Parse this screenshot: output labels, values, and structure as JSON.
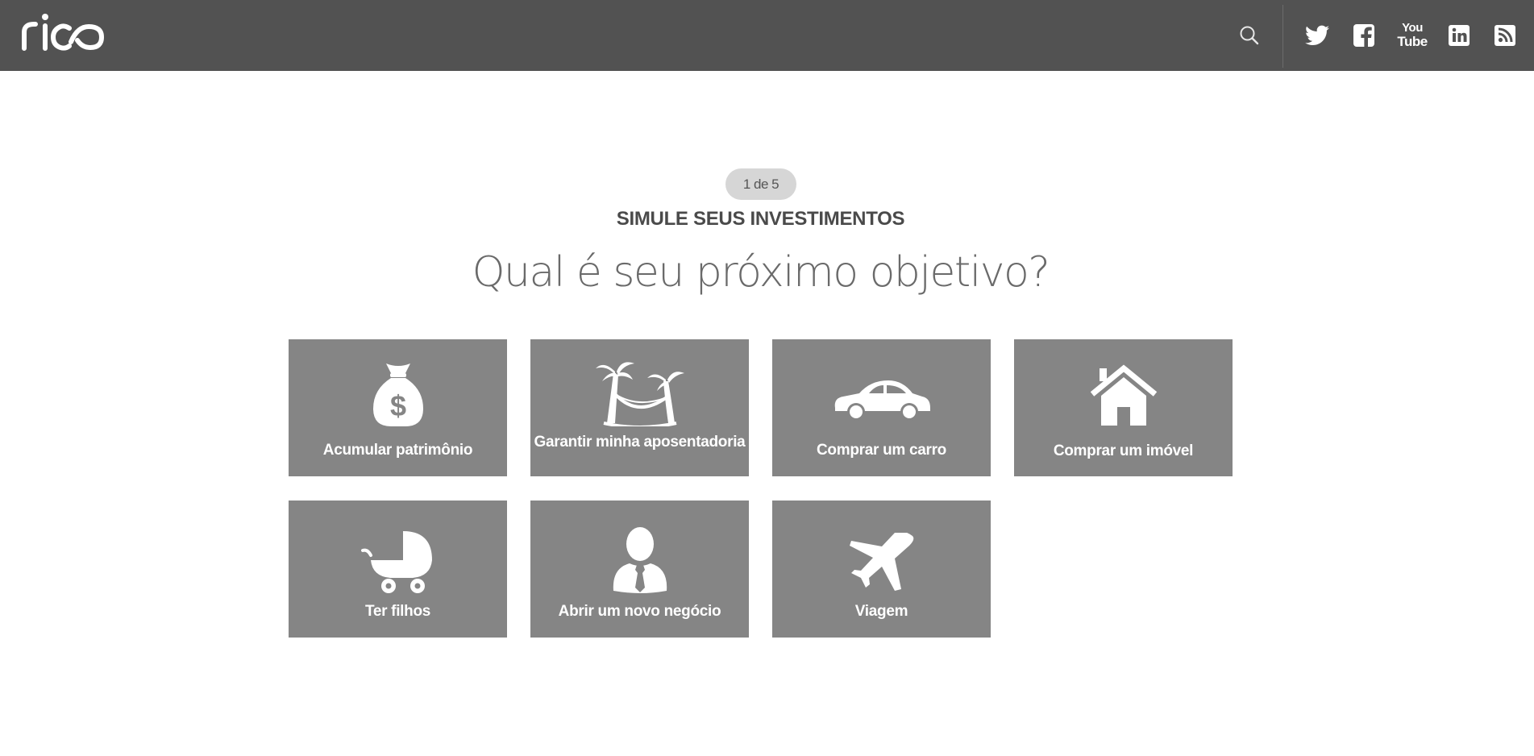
{
  "header": {
    "logo_text": "rico",
    "icons": [
      "search-icon",
      "twitter-icon",
      "facebook-icon",
      "youtube-icon",
      "linkedin-icon",
      "rss-icon"
    ],
    "youtube_text": [
      "You",
      "Tube"
    ]
  },
  "step": {
    "label": "1 de 5"
  },
  "main": {
    "subtitle": "SIMULE SEUS INVESTIMENTOS",
    "headline": "Qual é seu próximo objetivo?"
  },
  "goals": [
    {
      "label": "Acumular patrimônio",
      "icon": "money-bag-icon"
    },
    {
      "label": "Garantir minha aposentadoria",
      "icon": "palm-hammock-icon"
    },
    {
      "label": "Comprar um carro",
      "icon": "car-icon"
    },
    {
      "label": "Comprar um imóvel",
      "icon": "house-icon"
    },
    {
      "label": "Ter filhos",
      "icon": "baby-stroller-icon"
    },
    {
      "label": "Abrir um novo negócio",
      "icon": "businessman-icon"
    },
    {
      "label": "Viagem",
      "icon": "airplane-icon"
    }
  ],
  "colors": {
    "topbar": "#525252",
    "card": "#858585",
    "pill": "#d6d6d6",
    "text_dark": "#4a4a4a"
  }
}
